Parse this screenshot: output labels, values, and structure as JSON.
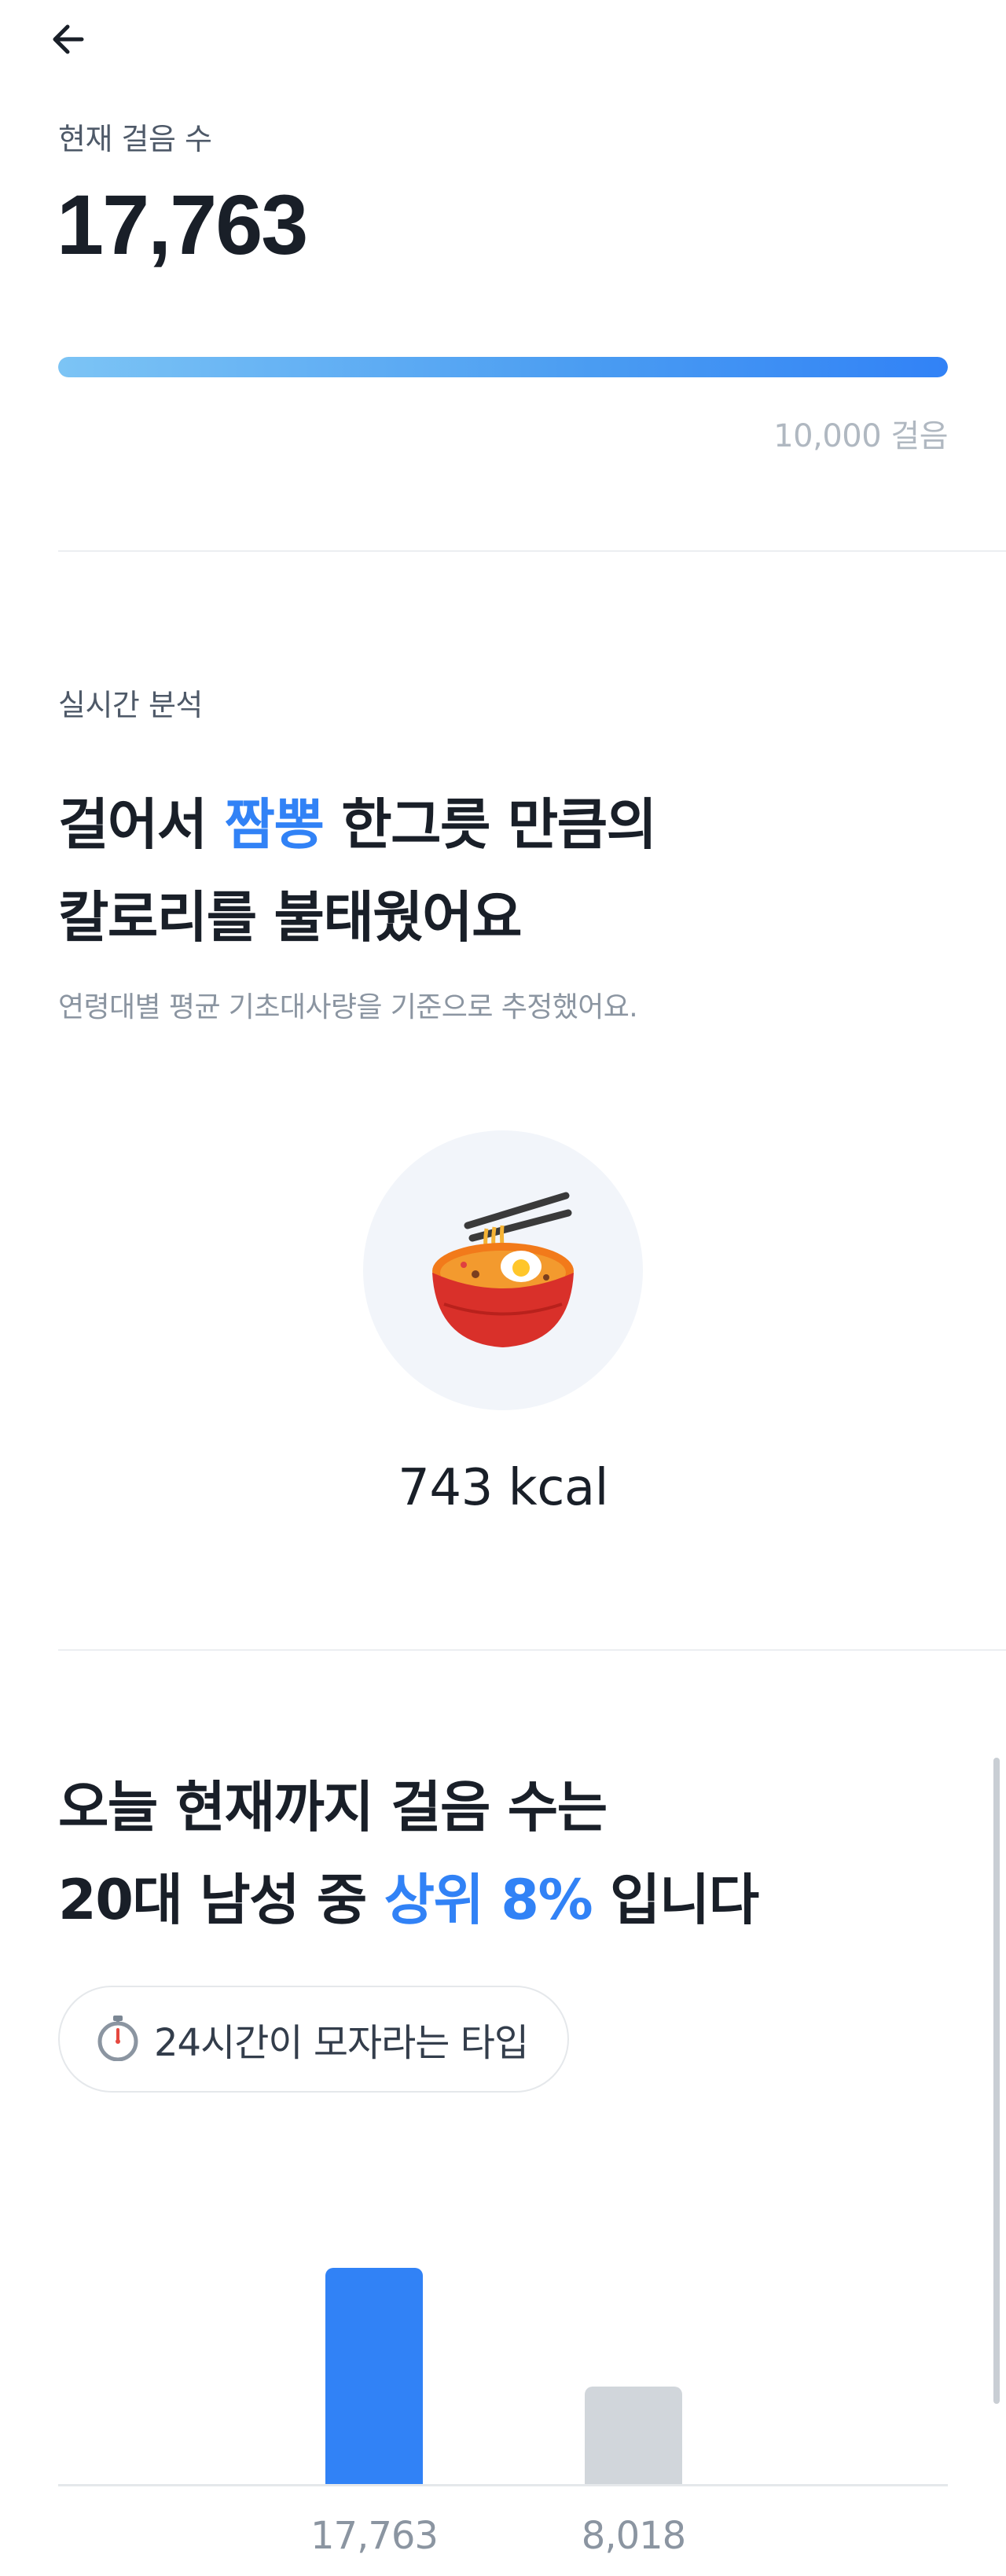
{
  "nav": {
    "back_icon": "arrow-left-icon"
  },
  "steps": {
    "label": "현재 걸음 수",
    "count": "17,763",
    "goal_label": "10,000 걸음",
    "progress_fraction": 1.0
  },
  "analysis": {
    "section_label": "실시간 분석",
    "headline_pre": "걸어서 ",
    "headline_food": "짬뽕",
    "headline_post": " 한그릇 만큼의",
    "headline_line2": "칼로리를 불태웠어요",
    "note": "연령대별 평균 기초대사량을 기준으로 추정했어요.",
    "food_icon": "noodle-bowl-icon",
    "kcal": "743 kcal"
  },
  "rank": {
    "line1": "오늘 현재까지 걸음 수는",
    "line2_pre": "20대 남성 중 ",
    "line2_accent": "상위 8%",
    "line2_post": " 입니다",
    "chip_icon": "stopwatch-icon",
    "chip_label": "24시간이 모자라는 타입"
  },
  "colors": {
    "accent": "#3182f6",
    "bar_user": "#3182f6",
    "bar_avg": "#d1d6db"
  },
  "chart_data": {
    "type": "bar",
    "categories": [
      "17,763",
      "8,018"
    ],
    "values": [
      17763,
      8018
    ],
    "ylim": [
      0,
      20000
    ]
  }
}
